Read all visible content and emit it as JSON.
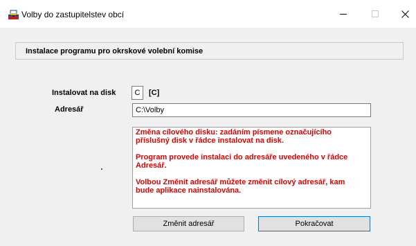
{
  "window": {
    "title": "Volby do zastupitelstev obcí",
    "controls": {
      "minimize": "–",
      "maximize": "□",
      "close": "✕"
    }
  },
  "section": {
    "title": "Instalace programu pro okrskové volební komise"
  },
  "form": {
    "install_on_disk_label": "Instalovat na disk",
    "drive_value": "C",
    "drive_display": "[C]",
    "directory_label": "Adresář",
    "directory_value": "C:\\Volby"
  },
  "info": {
    "paragraphs": [
      "Změna cílového disku: zadáním písmene označujícího příslušný disk v řádce instalovat na disk.",
      "Program provede instalaci do adresáře uvedeného v řádce Adresář.",
      "Volbou Změnit adresář můžete změnit cílový adresář, kam bude aplikace nainstalována."
    ],
    "text_color": "#e00000"
  },
  "buttons": {
    "change_dir": "Změnit adresář",
    "continue": "Pokračovat"
  },
  "icons": {
    "app": "ballot-box-icon"
  }
}
